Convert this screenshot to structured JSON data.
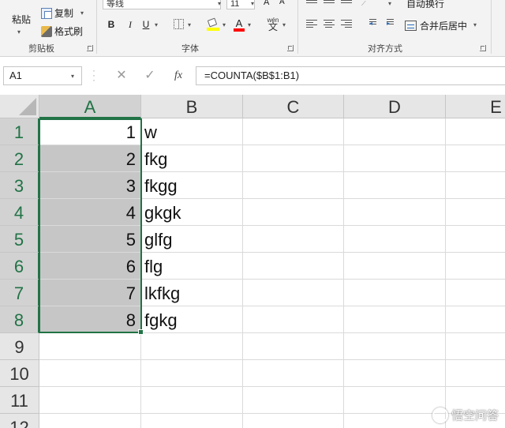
{
  "ribbon": {
    "clipboard": {
      "paste_label": "粘贴",
      "copy_label": "复制",
      "format_painter_label": "格式刷",
      "group_label": "剪贴板"
    },
    "font": {
      "font_name": "等线",
      "font_size": "11",
      "increase_size_glyph": "A",
      "decrease_size_glyph": "A",
      "bold_glyph": "B",
      "italic_glyph": "I",
      "underline_glyph": "U",
      "font_color_glyph": "A",
      "phonetic_glyph_top": "wén",
      "phonetic_glyph_bottom": "文",
      "group_label": "字体"
    },
    "alignment": {
      "wrap_text_label": "自动换行",
      "merge_center_label": "合并后居中",
      "group_label": "对齐方式"
    }
  },
  "formula_bar": {
    "name_box": "A1",
    "cancel_glyph": "✕",
    "enter_glyph": "✓",
    "fx_glyph": "fx",
    "formula": "=COUNTA($B$1:B1)"
  },
  "sheet": {
    "columns": [
      "A",
      "B",
      "C",
      "D",
      "E"
    ],
    "rows": [
      "1",
      "2",
      "3",
      "4",
      "5",
      "6",
      "7",
      "8",
      "9",
      "10",
      "11",
      "12"
    ],
    "col_a_values": [
      "1",
      "2",
      "3",
      "4",
      "5",
      "6",
      "7",
      "8"
    ],
    "col_b_values": [
      "w",
      "fkg",
      "fkgg",
      "gkgk",
      "glfg",
      "flg",
      "lkfkg",
      "fgkg"
    ]
  },
  "watermark": {
    "text": "悟空问答"
  },
  "colors": {
    "selection_green": "#217346",
    "selected_fill": "#c6c6c6",
    "header_bg": "#e6e6e6",
    "ribbon_bg": "#f3f3f3"
  }
}
